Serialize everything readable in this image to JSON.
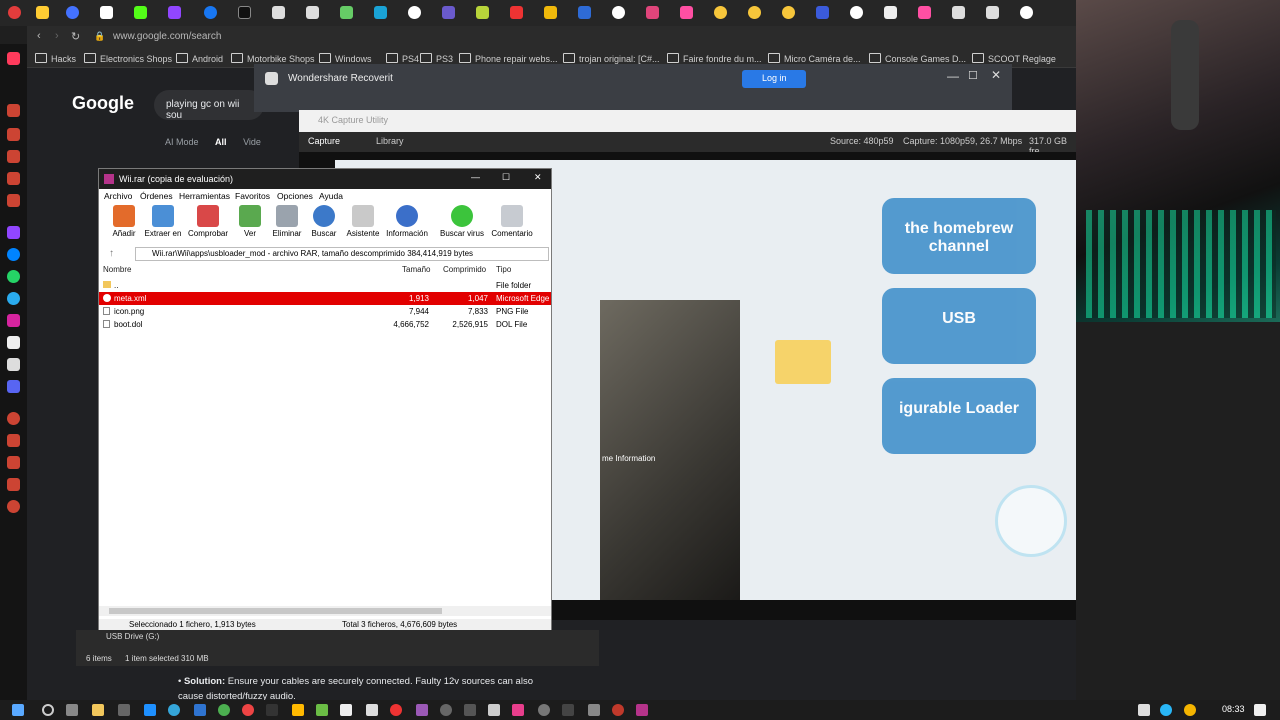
{
  "browser": {
    "url": "www.google.com/search",
    "bookmarks": [
      "Hacks",
      "Electronics Shops",
      "Android",
      "Motorbike Shops",
      "Windows",
      "PS4",
      "PS3",
      "Phone repair webs...",
      "trojan original: [C#...",
      "Faire fondre du m...",
      "Micro Caméra de...",
      "Console Games D...",
      "SCOOT Reglage"
    ]
  },
  "google": {
    "logo": "Google",
    "query": "playing gc on wii sou",
    "tabs": [
      "AI Mode",
      "All",
      "Vide"
    ],
    "solution_label": "Solution:",
    "solution_text": "Ensure your cables are securely connected. Faulty 12v sources can also cause distorted/fuzzy audio."
  },
  "recoverit": {
    "title": "Wondershare Recoverit",
    "login": "Log in"
  },
  "capture": {
    "title": "4K Capture Utility",
    "tabs": [
      "Capture",
      "Library"
    ],
    "source": "Source: 480p59",
    "capture_info": "Capture: 1080p59, 26.7 Mbps",
    "free": "317.0 GB fre",
    "wii_channels": [
      "the homebrew channel",
      "USB",
      "igurable Loader"
    ],
    "game_info": "me Information"
  },
  "winrar": {
    "title": "Wii.rar (copia de evaluación)",
    "menu": [
      "Archivo",
      "Órdenes",
      "Herramientas",
      "Favoritos",
      "Opciones",
      "Ayuda"
    ],
    "tools": [
      "Añadir",
      "Extraer en",
      "Comprobar",
      "Ver",
      "Eliminar",
      "Buscar",
      "Asistente",
      "Información",
      "Buscar virus",
      "Comentario"
    ],
    "path": "Wii.rar\\Wii\\apps\\usbloader_mod - archivo RAR, tamaño descomprimido 384,414,919 bytes",
    "columns": [
      "Nombre",
      "Tamaño",
      "Comprimido",
      "Tipo"
    ],
    "files": [
      {
        "name": "..",
        "size": "",
        "packed": "",
        "type": "File folder"
      },
      {
        "name": "meta.xml",
        "size": "1,913",
        "packed": "1,047",
        "type": "Microsoft Edge"
      },
      {
        "name": "icon.png",
        "size": "7,944",
        "packed": "7,833",
        "type": "PNG File"
      },
      {
        "name": "boot.dol",
        "size": "4,666,752",
        "packed": "2,526,915",
        "type": "DOL File"
      }
    ],
    "status_left": "Seleccionado 1 fichero, 1,913 bytes",
    "status_right": "Total 3 ficheros, 4,676,609 bytes"
  },
  "explorer": {
    "drive": "USB Drive (G:)",
    "items": "6 items",
    "selected": "1 item selected  310 MB"
  },
  "taskbar": {
    "time": "08:33"
  }
}
